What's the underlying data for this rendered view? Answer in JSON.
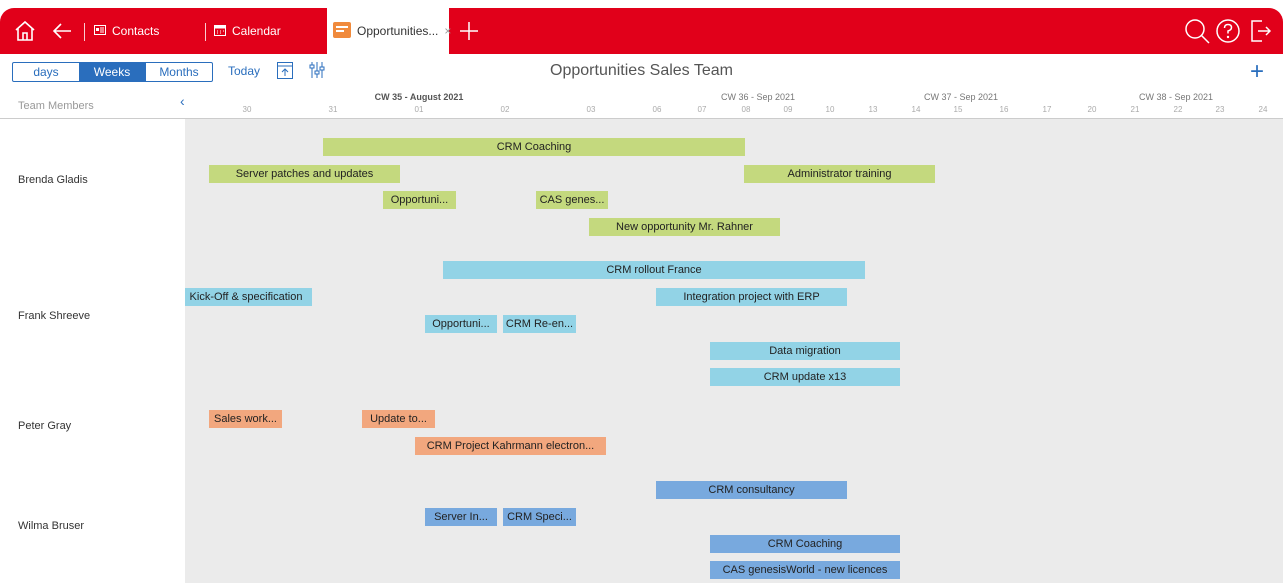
{
  "nav": {
    "tabs": [
      {
        "label": "Contacts"
      },
      {
        "label": "Calendar"
      },
      {
        "label": "Opportunities..."
      }
    ]
  },
  "toolbar": {
    "views": [
      "days",
      "Weeks",
      "Months"
    ],
    "active_view": "Weeks",
    "today": "Today",
    "title": "Opportunities Sales Team"
  },
  "header": {
    "team_members": "Team Members",
    "weeks": [
      {
        "label": "CW 35 - August 2021",
        "bold": true
      },
      {
        "label": "CW 36 - Sep 2021"
      },
      {
        "label": "CW 37 - Sep 2021"
      },
      {
        "label": "CW 38 - Sep 2021"
      }
    ],
    "days": [
      "30",
      "31",
      "01",
      "02",
      "03",
      "06",
      "07",
      "08",
      "09",
      "10",
      "13",
      "14",
      "15",
      "16",
      "17",
      "20",
      "21",
      "22",
      "23",
      "24"
    ]
  },
  "members": [
    {
      "name": "Brenda Gladis",
      "tasks": [
        {
          "label": "CRM Coaching"
        },
        {
          "label": "Server patches and updates"
        },
        {
          "label": "Administrator training"
        },
        {
          "label": "Opportuni..."
        },
        {
          "label": "CAS genes..."
        },
        {
          "label": "New opportunity Mr. Rahner"
        }
      ]
    },
    {
      "name": "Frank Shreeve",
      "tasks": [
        {
          "label": "CRM rollout France"
        },
        {
          "label": "Kick-Off & specification"
        },
        {
          "label": "Integration project with ERP"
        },
        {
          "label": "Opportuni..."
        },
        {
          "label": "CRM Re-en..."
        },
        {
          "label": "Data migration"
        },
        {
          "label": "CRM update x13"
        }
      ]
    },
    {
      "name": "Peter Gray",
      "tasks": [
        {
          "label": "Sales work..."
        },
        {
          "label": "Update to..."
        },
        {
          "label": "CRM Project Kahrmann electron..."
        }
      ]
    },
    {
      "name": "Wilma Bruser",
      "tasks": [
        {
          "label": "CRM consultancy"
        },
        {
          "label": "Server In..."
        },
        {
          "label": "CRM Speci..."
        },
        {
          "label": "CRM Coaching"
        },
        {
          "label": "CAS genesisWorld - new licences"
        }
      ]
    }
  ],
  "colors": {
    "brand": "#e1001a",
    "accent": "#2a6ebd"
  }
}
